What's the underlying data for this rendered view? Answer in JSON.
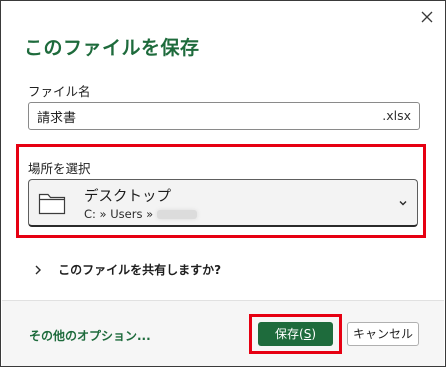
{
  "dialog": {
    "title": "このファイルを保存",
    "close_icon": "close-icon"
  },
  "filename": {
    "label": "ファイル名",
    "value": "請求書",
    "extension": ".xlsx"
  },
  "location": {
    "label": "場所を選択",
    "name": "デスクトップ",
    "path_prefix": "C: » Users »",
    "icon": "folder-icon",
    "dropdown_icon": "chevron-down-icon"
  },
  "share": {
    "label": "このファイルを共有しますか?",
    "icon": "chevron-right-icon"
  },
  "footer": {
    "other_options": "その他のオプション...",
    "save_label_main": "保存(",
    "save_label_accel": "S",
    "save_label_end": ")",
    "cancel_label": "キャンセル"
  },
  "colors": {
    "accent": "#1e6b3c",
    "highlight_frame": "#e60012"
  }
}
